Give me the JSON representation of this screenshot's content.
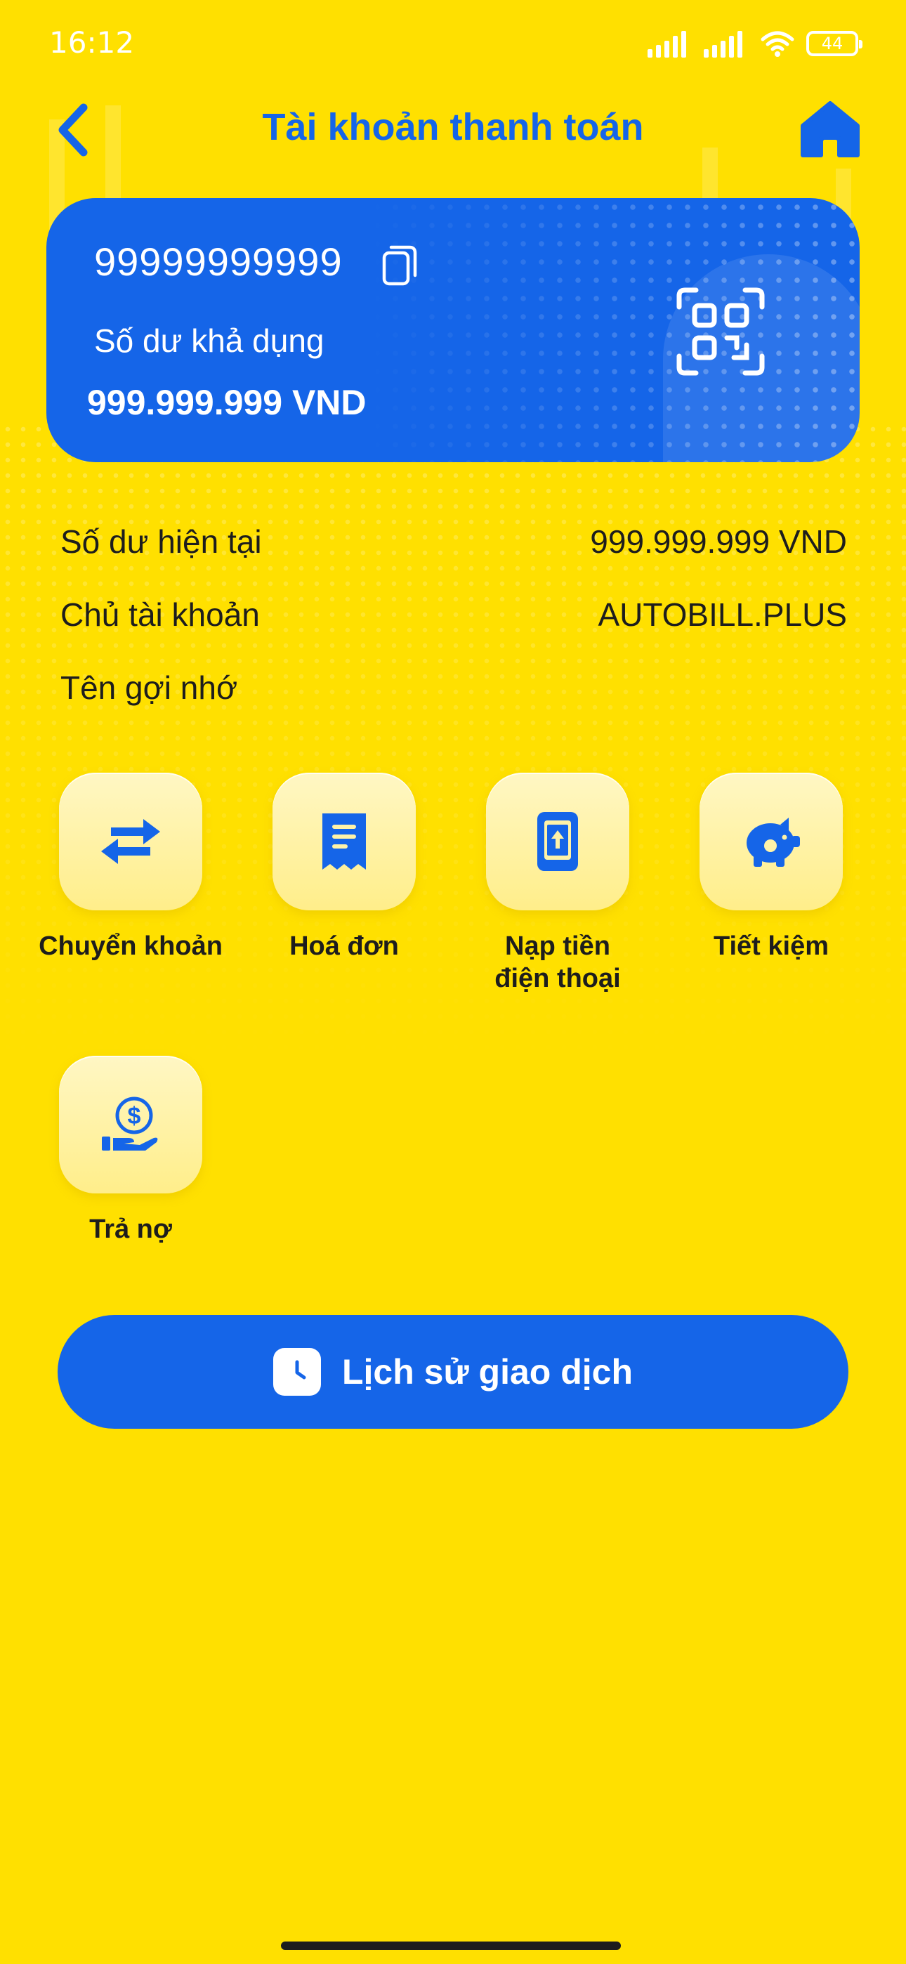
{
  "status_bar": {
    "time": "16:12",
    "battery": "44"
  },
  "header": {
    "title": "Tài khoản thanh toán",
    "back_icon": "chevron-left-icon",
    "home_icon": "home-icon"
  },
  "card": {
    "account_number": "99999999999",
    "balance_label": "Số dư khả dụng",
    "balance_value": "999.999.999 VND",
    "copy_icon": "copy-icon",
    "qr_icon": "qr-code-icon"
  },
  "info": {
    "current_balance_label": "Số dư hiện tại",
    "current_balance_value": "999.999.999 VND",
    "owner_label": "Chủ tài khoản",
    "owner_value": "AUTOBILL.PLUS",
    "nickname_label": "Tên gợi nhớ"
  },
  "actions": [
    {
      "label": "Chuyển khoản",
      "icon": "transfer-icon"
    },
    {
      "label": "Hoá đơn",
      "icon": "receipt-icon"
    },
    {
      "label": "Nạp tiền\nđiện thoại",
      "icon": "phone-topup-icon"
    },
    {
      "label": "Tiết kiệm",
      "icon": "piggy-bank-icon"
    },
    {
      "label": "Trả nợ",
      "icon": "debt-payment-icon"
    }
  ],
  "history": {
    "label": "Lịch sử giao dịch",
    "icon": "clock-icon"
  },
  "colors": {
    "background": "#FFE000",
    "primary": "#1565E8",
    "text": "#1D1D1D",
    "tile": "#FFF3A8"
  }
}
